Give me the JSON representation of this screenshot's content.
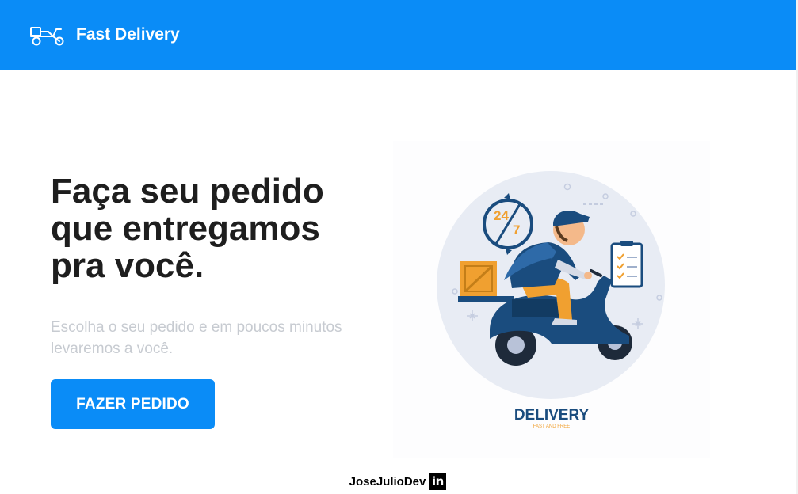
{
  "header": {
    "brand": "Fast Delivery",
    "logo_icon": "scooter-icon",
    "bg_color": "#0a8cf7"
  },
  "hero": {
    "title": "Faça seu pedido que entregamos pra você.",
    "subtitle": "Escolha o seu pedido e em poucos minutos levaremos a você.",
    "cta_label": "FAZER PEDIDO"
  },
  "illustration": {
    "badge_text_24": "24",
    "badge_text_7": "7",
    "caption": "DELIVERY",
    "caption_sub": "FAST AND FREE"
  },
  "footer": {
    "author": "JoseJulioDev",
    "social_icon": "linkedin-icon",
    "social_label": "in"
  }
}
